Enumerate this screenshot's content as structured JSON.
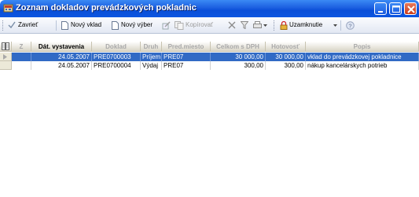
{
  "window": {
    "title": "Zoznam dokladov prevádzkových pokladnic"
  },
  "toolbar": {
    "close": "Zavrieť",
    "new_entry": "Nový vklad",
    "new_withdrawal": "Nový výber",
    "copy": "Kopírovať",
    "lock": "Uzamknutie"
  },
  "table": {
    "columns": [
      "Dát. vystavenia",
      "Doklad",
      "Druh",
      "Pred.miesto",
      "Celkom s DPH",
      "Hotovosť",
      "Popis"
    ],
    "rows": [
      {
        "date": "24.05.2007",
        "doc": "PRE0700003",
        "kind": "Príjem",
        "place": "PRE07",
        "total": "30 000,00",
        "cash": "30 000,00",
        "desc": "vklad do prevádzkovej pokladnice"
      },
      {
        "date": "24.05.2007",
        "doc": "PRE0700004",
        "kind": "Výdaj",
        "place": "PRE07",
        "total": "300,00",
        "cash": "300,00",
        "desc": "nákup kancelárskych potrieb"
      }
    ],
    "header_z": "Z"
  }
}
